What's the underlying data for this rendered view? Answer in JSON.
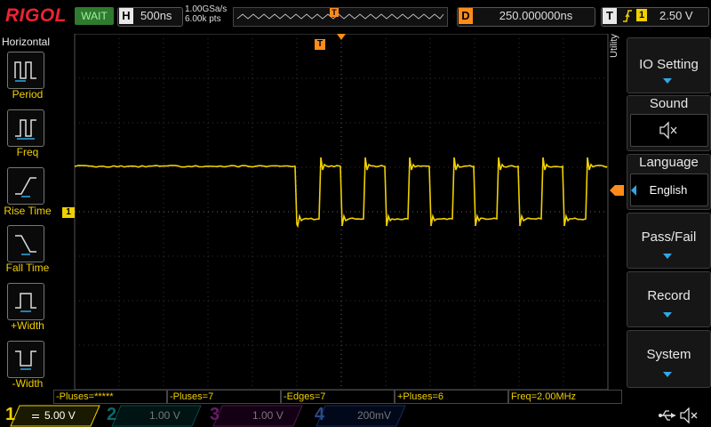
{
  "header": {
    "logo": "RIGOL",
    "run_status": "WAIT",
    "horizontal_label": "H",
    "timebase": "500ns",
    "sample_rate": "1.00GSa/s",
    "memory_depth": "6.00k pts",
    "delay_label": "D",
    "delay": "250.000000ns",
    "trigger_label": "T",
    "trigger_source": "1",
    "trigger_level": "2.50 V"
  },
  "left_menu": {
    "title": "Horizontal",
    "items": [
      {
        "label": "Period",
        "icon": "period-icon"
      },
      {
        "label": "Freq",
        "icon": "freq-icon"
      },
      {
        "label": "Rise Time",
        "icon": "rise-time-icon"
      },
      {
        "label": "Fall Time",
        "icon": "fall-time-icon"
      },
      {
        "label": "+Width",
        "icon": "positive-width-icon"
      },
      {
        "label": "-Width",
        "icon": "negative-width-icon"
      }
    ]
  },
  "right_menu": {
    "title": "Utility",
    "items": [
      {
        "label": "IO Setting",
        "has_arrow": true
      },
      {
        "label": "Sound",
        "value_icon": "speaker-mute-icon"
      },
      {
        "label": "Language",
        "value": "English"
      },
      {
        "label": "Pass/Fail",
        "has_arrow": true
      },
      {
        "label": "Record",
        "has_arrow": true
      },
      {
        "label": "System",
        "has_arrow": true
      }
    ]
  },
  "measurements": [
    "-Pluses=*****",
    "-Pluses=7",
    "-Edges=7",
    "+Pluses=6",
    "Freq=2.00MHz"
  ],
  "channels": [
    {
      "num": "1",
      "value": "5.00 V",
      "color": "#f0d000",
      "active": true
    },
    {
      "num": "2",
      "value": "1.00 V",
      "color": "#00c8c8",
      "active": false
    },
    {
      "num": "3",
      "value": "1.00 V",
      "color": "#d040d0",
      "active": false
    },
    {
      "num": "4",
      "value": "200mV",
      "color": "#3080ff",
      "active": false
    }
  ],
  "markers": {
    "trigger_marker": "T",
    "channel_marker": "1"
  },
  "colors": {
    "ch1": "#f0d000",
    "accent": "#2fa8e8",
    "trigger": "#ff8c1a",
    "status_bg": "#2f7a2f"
  }
}
